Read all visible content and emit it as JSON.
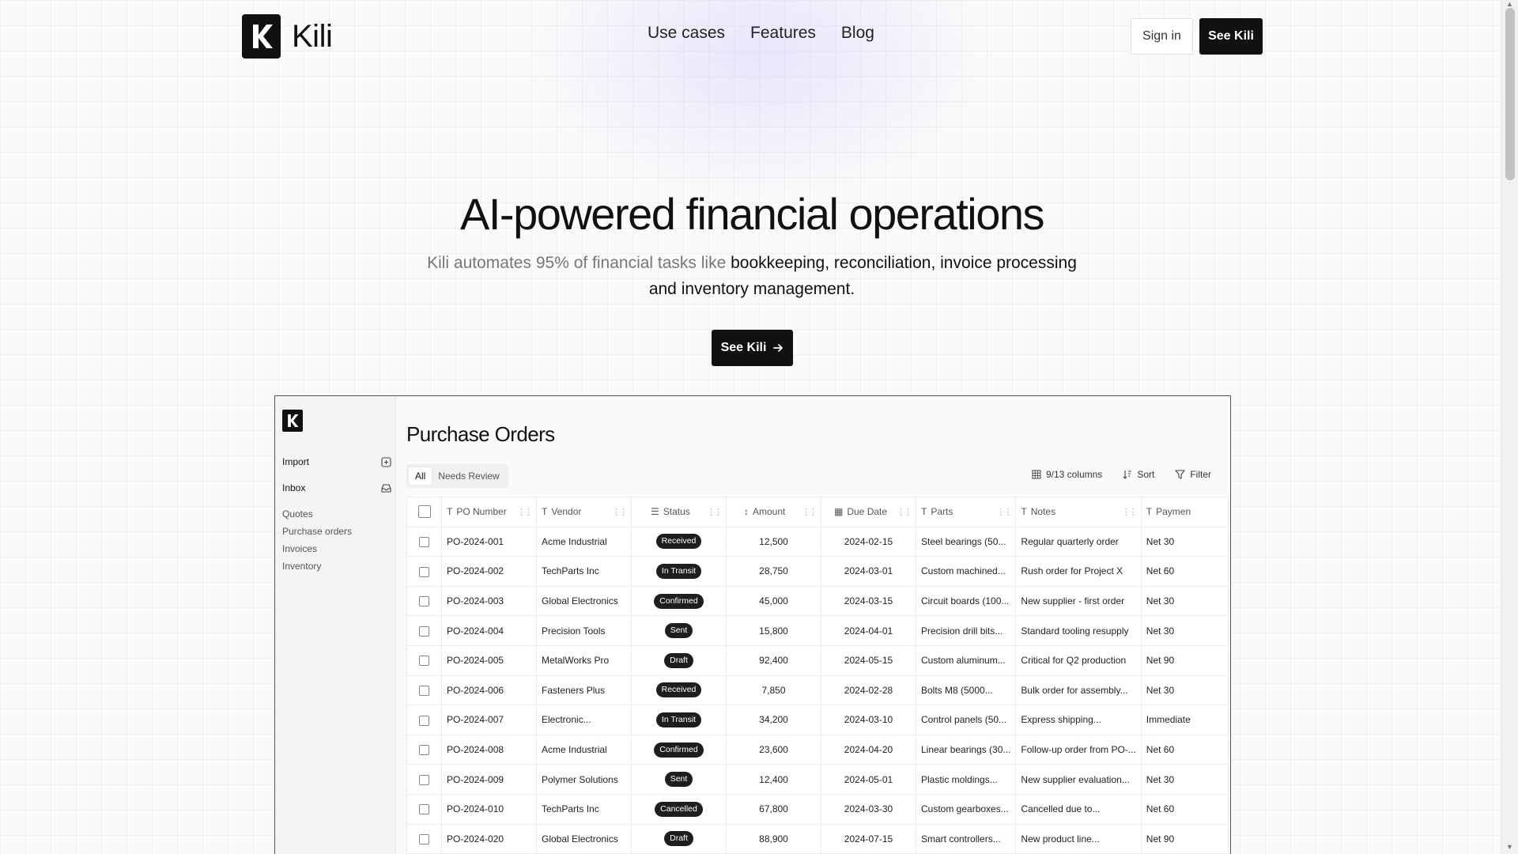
{
  "brand": {
    "name": "Kili",
    "logo_letter": "K"
  },
  "nav": {
    "links": [
      "Use cases",
      "Features",
      "Blog"
    ],
    "sign_in": "Sign in",
    "cta": "See Kili"
  },
  "hero": {
    "title": "AI-powered financial operations",
    "subtitle_light": "Kili automates 95% of financial tasks like ",
    "subtitle_dark": "bookkeeping, reconciliation, invoice processing and inventory management",
    "subtitle_end": ".",
    "cta": "See Kili"
  },
  "app": {
    "sidebar": {
      "import": "Import",
      "inbox": "Inbox",
      "items": [
        "Quotes",
        "Purchase orders",
        "Invoices",
        "Inventory"
      ]
    },
    "page_title": "Purchase Orders",
    "tabs": [
      "All",
      "Needs Review"
    ],
    "toolbar": {
      "columns": "9/13 columns",
      "sort": "Sort",
      "filter": "Filter"
    },
    "columns": [
      "PO Number",
      "Vendor",
      "Status",
      "Amount",
      "Due Date",
      "Parts",
      "Notes",
      "Paymen"
    ],
    "rows": [
      {
        "po": "PO-2024-001",
        "vendor": "Acme Industrial",
        "status": "Received",
        "amount": "12,500",
        "due": "2024-02-15",
        "parts": "Steel bearings (50...",
        "notes": "Regular quarterly order",
        "payment": "Net 30"
      },
      {
        "po": "PO-2024-002",
        "vendor": "TechParts Inc",
        "status": "In Transit",
        "amount": "28,750",
        "due": "2024-03-01",
        "parts": "Custom machined...",
        "notes": "Rush order for Project X",
        "payment": "Net 60"
      },
      {
        "po": "PO-2024-003",
        "vendor": "Global Electronics",
        "status": "Confirmed",
        "amount": "45,000",
        "due": "2024-03-15",
        "parts": "Circuit boards (100...",
        "notes": "New supplier - first order",
        "payment": "Net 30"
      },
      {
        "po": "PO-2024-004",
        "vendor": "Precision Tools",
        "status": "Sent",
        "amount": "15,800",
        "due": "2024-04-01",
        "parts": "Precision drill bits...",
        "notes": "Standard tooling resupply",
        "payment": "Net 30"
      },
      {
        "po": "PO-2024-005",
        "vendor": "MetalWorks Pro",
        "status": "Draft",
        "amount": "92,400",
        "due": "2024-05-15",
        "parts": "Custom aluminum...",
        "notes": "Critical for Q2 production",
        "payment": "Net 90"
      },
      {
        "po": "PO-2024-006",
        "vendor": "Fasteners Plus",
        "status": "Received",
        "amount": "7,850",
        "due": "2024-02-28",
        "parts": "Bolts M8 (5000...",
        "notes": "Bulk order for assembly...",
        "payment": "Net 30"
      },
      {
        "po": "PO-2024-007",
        "vendor": "Electronic...",
        "status": "In Transit",
        "amount": "34,200",
        "due": "2024-03-10",
        "parts": "Control panels (50...",
        "notes": "Express shipping...",
        "payment": "Immediate"
      },
      {
        "po": "PO-2024-008",
        "vendor": "Acme Industrial",
        "status": "Confirmed",
        "amount": "23,600",
        "due": "2024-04-20",
        "parts": "Linear bearings (30...",
        "notes": "Follow-up order from PO-...",
        "payment": "Net 60"
      },
      {
        "po": "PO-2024-009",
        "vendor": "Polymer Solutions",
        "status": "Sent",
        "amount": "12,400",
        "due": "2024-05-01",
        "parts": "Plastic moldings...",
        "notes": "New supplier evaluation...",
        "payment": "Net 30"
      },
      {
        "po": "PO-2024-010",
        "vendor": "TechParts Inc",
        "status": "Cancelled",
        "amount": "67,800",
        "due": "2024-03-30",
        "parts": "Custom gearboxes...",
        "notes": "Cancelled due to...",
        "payment": "Net 60"
      },
      {
        "po": "PO-2024-020",
        "vendor": "Global Electronics",
        "status": "Draft",
        "amount": "88,900",
        "due": "2024-07-15",
        "parts": "Smart controllers...",
        "notes": "New product line...",
        "payment": "Net 90"
      }
    ]
  }
}
